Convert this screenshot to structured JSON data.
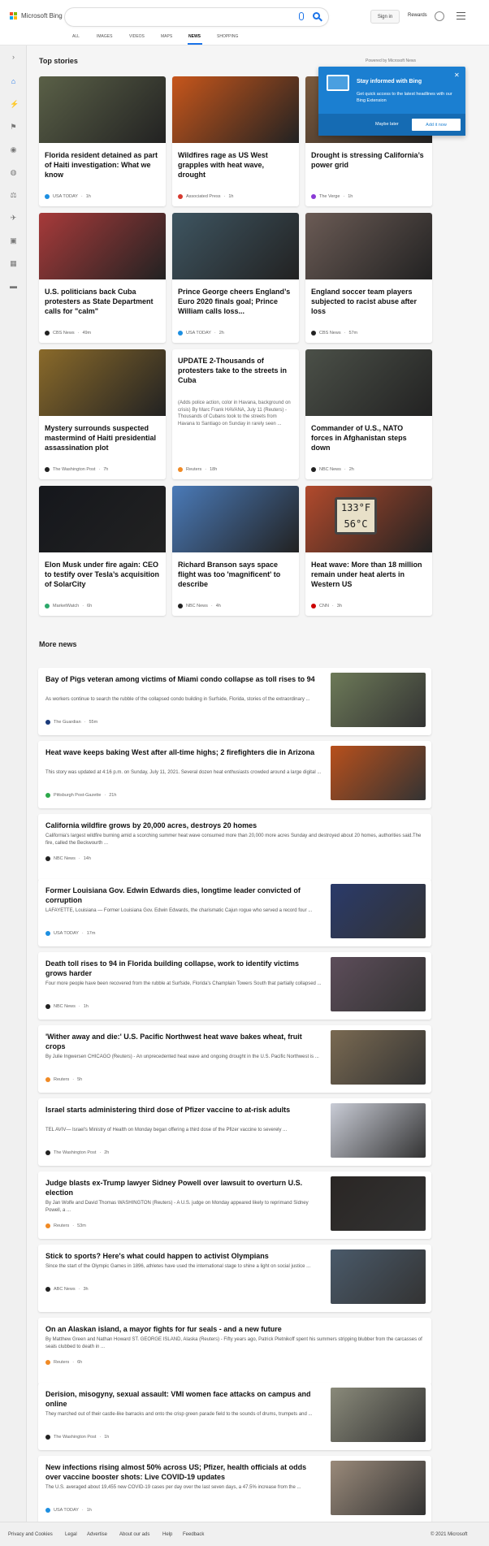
{
  "header": {
    "brand": "Microsoft Bing",
    "signin": "Sign in",
    "rewards": "Rewards"
  },
  "nav": [
    "ALL",
    "IMAGES",
    "VIDEOS",
    "MAPS",
    "NEWS",
    "SHOPPING"
  ],
  "top_stories": {
    "title": "Top stories",
    "powered_by": "Powered by Microsoft News"
  },
  "popup": {
    "title": "Stay informed with Bing",
    "text": "Get quick access to the latest headlines with our Bing Extension",
    "maybe_later": "Maybe later",
    "add_it": "Add it now"
  },
  "cards": [
    {
      "title": "Florida resident detained as part of Haiti investigation: What we know",
      "source": "USA TODAY",
      "time": "1h",
      "src_color": "#1d8fe1",
      "img": "#5a6047"
    },
    {
      "title": "Wildfires rage as US West grapples with heat wave, drought",
      "source": "Associated Press",
      "time": "1h",
      "src_color": "#d63a2f",
      "img": "#c7561b"
    },
    {
      "title": "Drought is stressing California’s power grid",
      "source": "The Verge",
      "time": "1h",
      "src_color": "#8a3ad6",
      "img": "#7c5a3d"
    },
    {
      "title": "U.S. politicians back Cuba protesters as State Department calls for \"calm\"",
      "source": "CBS News",
      "time": "49m",
      "src_color": "#222222",
      "img": "#a73a3a"
    },
    {
      "title": "Prince George cheers England’s Euro 2020 finals goal; Prince William calls loss...",
      "source": "USA TODAY",
      "time": "2h",
      "src_color": "#1d8fe1",
      "img": "#3e5561"
    },
    {
      "title": "England soccer team players subjected to racist abuse after loss",
      "source": "CBS News",
      "time": "57m",
      "src_color": "#222222",
      "img": "#6b5b55"
    },
    {
      "title": "Mystery surrounds suspected mastermind of Haiti presidential assassination plot",
      "source": "The Washington Post",
      "time": "7h",
      "src_color": "#222222",
      "img": "#8a6a2a"
    },
    {
      "title": "UPDATE 2-Thousands of protesters take to the streets in Cuba",
      "snippet": "(Adds police action, color in Havana, background on crisis) By Marc Frank HAVANA, July 11 (Reuters) - Thousands of Cubans took to the streets from Havana to Santiago on Sunday in rarely seen ...",
      "source": "Reuters",
      "time": "18h",
      "src_color": "#f08a24"
    },
    {
      "title": "Commander of U.S., NATO forces in Afghanistan steps down",
      "source": "NBC News",
      "time": "2h",
      "src_color": "#222222",
      "img": "#4b5048"
    },
    {
      "title": "Elon Musk under fire again: CEO to testify over Tesla’s acquisition of SolarCity",
      "source": "MarketWatch",
      "time": "6h",
      "src_color": "#2ca86a",
      "img": "#15171c"
    },
    {
      "title": "Richard Branson says space flight was too 'magnificent' to describe",
      "source": "NBC News",
      "time": "4h",
      "src_color": "#222222",
      "img": "#4a7ab8"
    },
    {
      "title": "Heat wave: More than 18 million remain under heat alerts in Western US",
      "source": "CNN",
      "time": "3h",
      "src_color": "#cc0000",
      "img": "#b24a2c",
      "thermo": [
        "133°F",
        "56°C"
      ]
    }
  ],
  "more_news": {
    "title": "More news",
    "items": [
      {
        "title": "Bay of Pigs veteran among victims of Miami condo collapse as toll rises to 94",
        "snippet": "As workers continue to search the rubble of the collapsed condo building in Surfside, Florida, stories of the extraordinary ...",
        "source": "The Guardian",
        "time": "55m",
        "src_color": "#1a3a7a",
        "img": "#6d7a58"
      },
      {
        "title": "Heat wave keeps baking West after all-time highs; 2 firefighters die in Arizona",
        "snippet": "This story was updated at 4:16 p.m. on Sunday, July 11, 2021. Several dozen heat enthusiasts crowded around a large digital ...",
        "source": "Pittsburgh Post-Gazette",
        "time": "21h",
        "src_color": "#2ca84a",
        "img": "#b8501c"
      },
      {
        "title": "California wildfire grows by 20,000 acres, destroys 20 homes",
        "snippet": "California's largest wildfire burning amid a scorching summer heat wave consumed more than 20,000 more acres Sunday and destroyed about 20 homes, authorities said.The fire, called the Beckwourth ...",
        "source": "NBC News",
        "time": "14h",
        "src_color": "#222222"
      },
      {
        "title": "Former Louisiana Gov. Edwin Edwards dies, longtime leader convicted of corruption",
        "snippet": "LAFAYETTE, Louisiana — Former Louisiana Gov. Edwin Edwards, the charismatic Cajun rogue who served a record four ...",
        "source": "USA TODAY",
        "time": "17m",
        "src_color": "#1d8fe1",
        "img": "#2a3a6a"
      },
      {
        "title": "Death toll rises to 94 in Florida building collapse, work to identify victims grows harder",
        "snippet": "Four more people have been recovered from the rubble at Surfside, Florida's Champlain Towers South that partially collapsed ...",
        "source": "NBC News",
        "time": "1h",
        "src_color": "#222222",
        "img": "#5d4d5a"
      },
      {
        "title": "'Wither away and die:' U.S. Pacific Northwest heat wave bakes wheat, fruit crops",
        "snippet": "By Julie Ingwersen CHICAGO (Reuters) - An unprecedented heat wave and ongoing drought in the U.S. Pacific Northwest is ...",
        "source": "Reuters",
        "time": "5h",
        "src_color": "#f08a24",
        "img": "#7a6a52"
      },
      {
        "title": "Israel starts administering third dose of Pfizer vaccine to at-risk adults",
        "snippet": "TEL AVIV— Israel's Ministry of Health on Monday began offering a third dose of the Pfizer vaccine to severely ...",
        "source": "The Washington Post",
        "time": "2h",
        "src_color": "#222222",
        "img": "#c9ccd6"
      },
      {
        "title": "Judge blasts ex-Trump lawyer Sidney Powell over lawsuit to overturn U.S. election",
        "snippet": "By Jan Wolfe and David Thomas WASHINGTON (Reuters) - A U.S. judge on Monday appeared likely to reprimand Sidney Powell, a ...",
        "source": "Reuters",
        "time": "53m",
        "src_color": "#f08a24",
        "img": "#2a2624"
      },
      {
        "title": "Stick to sports? Here's what could happen to activist Olympians",
        "snippet": "Since the start of the Olympic Games in 1896, athletes have used the international stage to shine a light on social justice ...",
        "source": "ABC News",
        "time": "3h",
        "src_color": "#222222",
        "img": "#4a5a6a"
      },
      {
        "title": "On an Alaskan island, a mayor fights for fur seals - and a new future",
        "snippet": "By Matthew Green and Nathan Howard ST. GEORGE ISLAND, Alaska (Reuters) - Fifty years ago, Patrick Pletnikoff spent his summers stripping blubber from the carcasses of seals clubbed to death in ...",
        "source": "Reuters",
        "time": "6h",
        "src_color": "#f08a24"
      },
      {
        "title": "Derision, misogyny, sexual assault: VMI women face attacks on campus and online",
        "snippet": "They marched out of their castle-like barracks and onto the crisp green parade field to the sounds of drums, trumpets and ...",
        "source": "The Washington Post",
        "time": "1h",
        "src_color": "#222222",
        "img": "#8a8a7a"
      },
      {
        "title": "New infections rising almost 50% across US; Pfizer, health officials at odds over vaccine booster shots: Live COVID-19 updates",
        "snippet": "The U.S. averaged about 19,455 new COVID-19 cases per day over the last seven days, a 47.5% increase from the ...",
        "source": "USA TODAY",
        "time": "1h",
        "src_color": "#1d8fe1",
        "img": "#9a8a7a"
      }
    ]
  },
  "footer": {
    "links": [
      "Privacy and Cookies",
      "Legal",
      "Advertise",
      "About our ads",
      "Help",
      "Feedback"
    ],
    "copyright": "© 2021 Microsoft"
  }
}
